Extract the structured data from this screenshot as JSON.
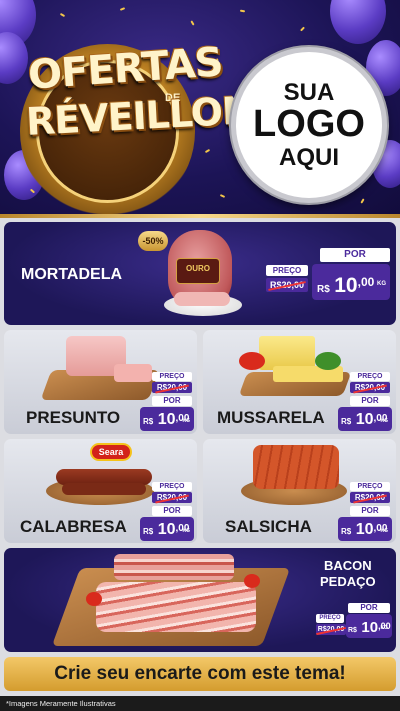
{
  "header": {
    "title_line1": "OFERTAS",
    "title_de": "DE",
    "title_line2": "RÉVEILLON",
    "logo_line1": "SUA",
    "logo_line2": "LOGO",
    "logo_line3": "AQUI"
  },
  "products": {
    "mortadela": {
      "name": "MORTADELA",
      "discount_badge": "-50%",
      "brand_label": "OURO",
      "preco_label": "PREÇO",
      "old_price": "R$20,00",
      "por_label": "POR",
      "currency": "R$",
      "price_int": "10",
      "price_dec": ",00",
      "unit": "KG"
    },
    "presunto": {
      "name": "PRESUNTO",
      "preco_label": "PREÇO",
      "old_price": "R$20,00",
      "por_label": "POR",
      "currency": "R$",
      "price_int": "10",
      "price_dec": ",00",
      "unit": "KG"
    },
    "mussarela": {
      "name": "MUSSARELA",
      "preco_label": "PREÇO",
      "old_price": "R$20,00",
      "por_label": "POR",
      "currency": "R$",
      "price_int": "10",
      "price_dec": ",00",
      "unit": "KG"
    },
    "calabresa": {
      "name": "CALABRESA",
      "brand_label": "Seara",
      "preco_label": "PREÇO",
      "old_price": "R$20,00",
      "por_label": "POR",
      "currency": "R$",
      "price_int": "10",
      "price_dec": ",00",
      "unit": "KG"
    },
    "salsicha": {
      "name": "SALSICHA",
      "preco_label": "PREÇO",
      "old_price": "R$20,00",
      "por_label": "POR",
      "currency": "R$",
      "price_int": "10",
      "price_dec": ",00",
      "unit": "KG"
    },
    "bacon": {
      "name_line1": "BACON",
      "name_line2": "PEDAÇO",
      "preco_label": "PREÇO",
      "old_price": "R$20,00",
      "por_label": "POR",
      "currency": "R$",
      "price_int": "10",
      "price_dec": ",00",
      "unit": "KG"
    }
  },
  "footer": {
    "cta": "Crie seu encarte com este tema!",
    "disclaimer": "*Imagens Meramente Ilustrativas"
  },
  "colors": {
    "header_bg": "#1c1456",
    "card_dark": "#1e1758",
    "price_purple": "#4b2a9c",
    "gold": "#d49c2e"
  }
}
